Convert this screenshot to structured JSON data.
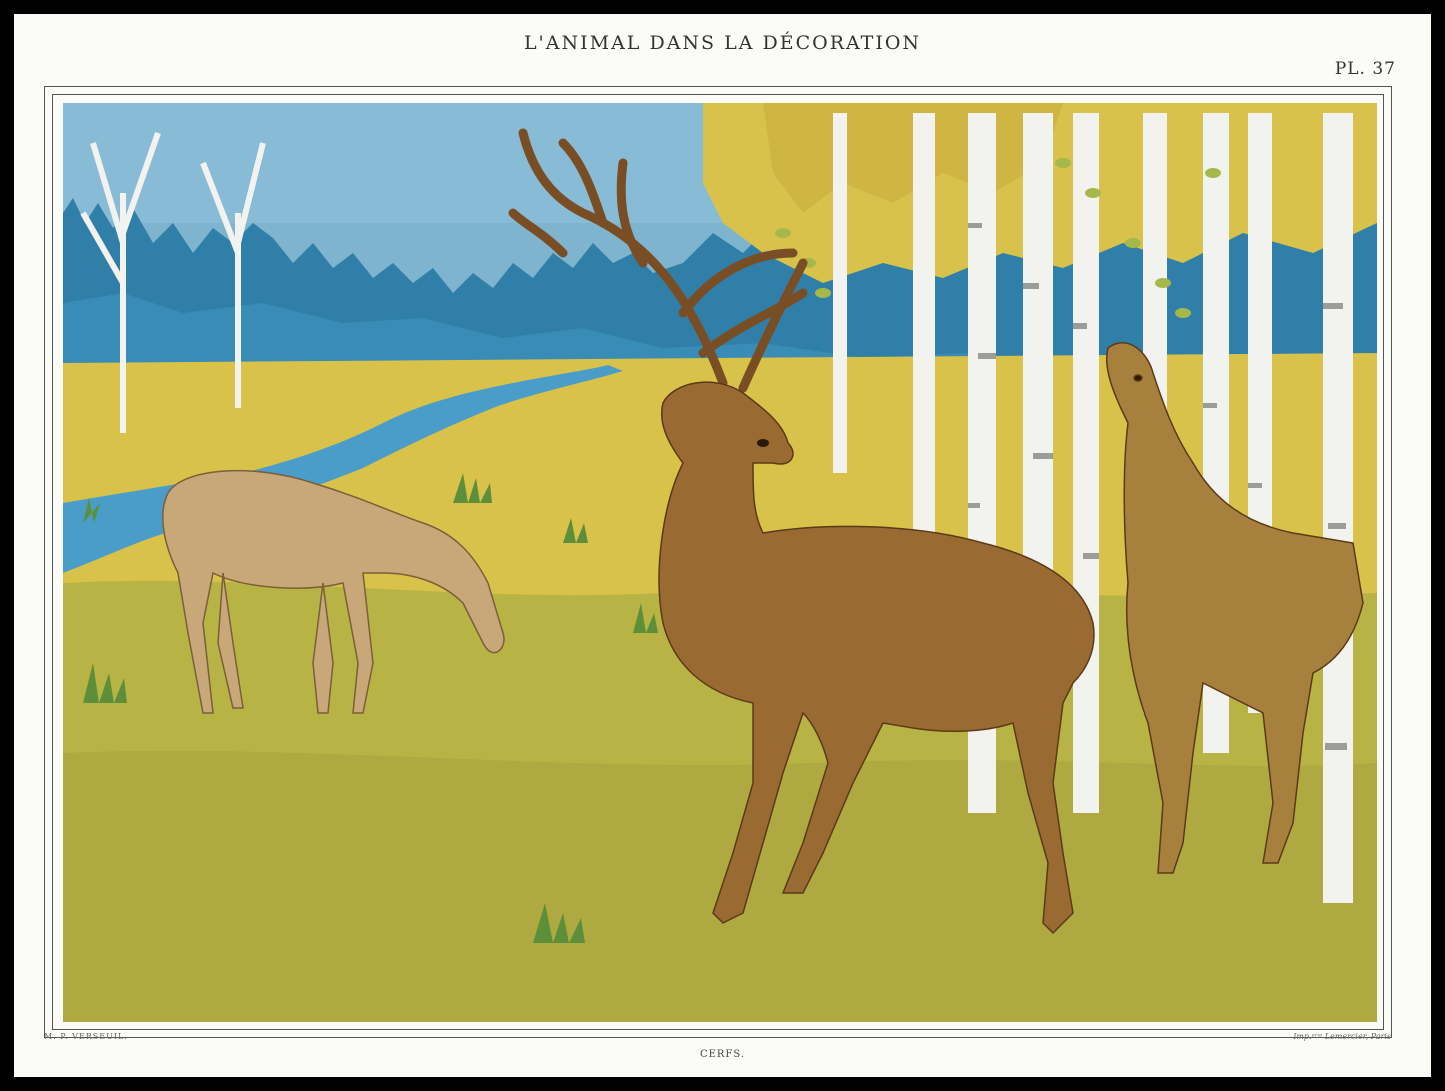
{
  "plate": {
    "title": "L'ANIMAL DANS LA DÉCORATION",
    "number": "PL. 37",
    "artist_credit": "M. P. VERSEUIL.",
    "printer_credit": "Imp.ᵉʳⁱᵉ Lemercier, Paris",
    "caption": "CERFS."
  },
  "colors": {
    "border": "#000000",
    "paper": "#fbfbf8",
    "sky": "#7fb4cf",
    "forest": "#2f7fa8",
    "meadow_far": "#d9c24a",
    "meadow_near": "#b8b345",
    "stream": "#4a9dc9",
    "stag": "#9a6a33",
    "doe": "#c8a878",
    "birch": "#f2f2ee"
  }
}
